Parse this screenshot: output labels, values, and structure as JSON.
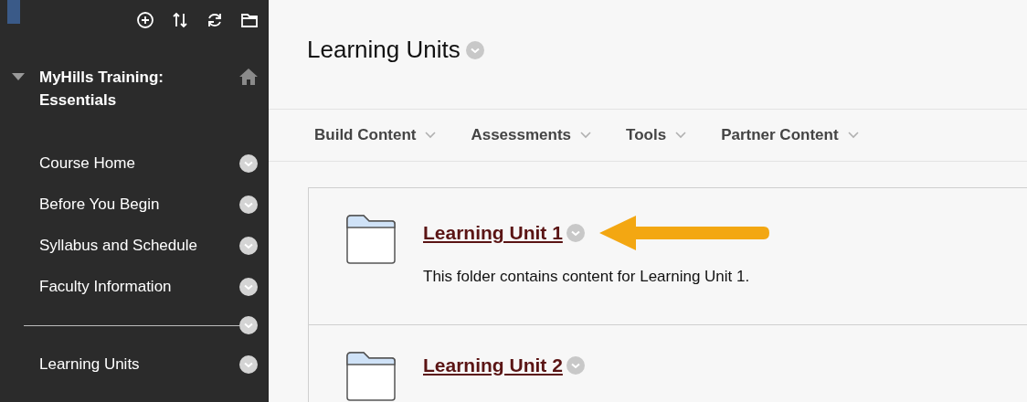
{
  "sidebar": {
    "course": {
      "title": "MyHills Training: Essentials",
      "expanded": true
    },
    "items": [
      {
        "kind": "link",
        "label": "Course Home"
      },
      {
        "kind": "link",
        "label": "Before You Begin"
      },
      {
        "kind": "link",
        "label": "Syllabus and Schedule"
      },
      {
        "kind": "link",
        "label": "Faculty Information"
      },
      {
        "kind": "divider"
      },
      {
        "kind": "link",
        "label": "Learning Units"
      }
    ]
  },
  "page": {
    "title": "Learning Units",
    "toolbar": [
      "Build Content",
      "Assessments",
      "Tools",
      "Partner Content"
    ],
    "content_items": [
      {
        "title": "Learning Unit 1",
        "description": "This folder contains content for Learning Unit 1.",
        "highlighted": true
      },
      {
        "title": "Learning Unit 2",
        "highlighted": false
      }
    ]
  }
}
